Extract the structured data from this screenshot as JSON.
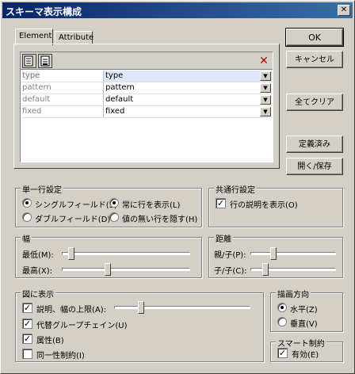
{
  "window": {
    "title": "スキーマ表示構成",
    "close_glyph": "✕"
  },
  "tabs": [
    {
      "label": "Element"
    },
    {
      "label": "Attribute"
    }
  ],
  "grid": {
    "rows": [
      {
        "name": "type",
        "value": "type"
      },
      {
        "name": "pattern",
        "value": "pattern"
      },
      {
        "name": "default",
        "value": "default"
      },
      {
        "name": "fixed",
        "value": "fixed"
      }
    ],
    "delete_glyph": "✕",
    "dropdown_glyph": "▼"
  },
  "buttons": {
    "ok": "OK",
    "cancel": "キャンセル",
    "clear_all": "全てクリア",
    "predefined": "定義済み",
    "open_save": "開く/保存"
  },
  "single_row": {
    "title": "単一行設定",
    "single_field": "シングルフィールド(S)",
    "double_field": "ダブルフィールド(D)",
    "always_show": "常に行を表示(L)",
    "hide_empty": "値の無い行を隠す(H)",
    "selected": "single_field,always_show"
  },
  "common_row": {
    "title": "共通行設定",
    "show_desc": "行の説明を表示(O)",
    "show_desc_checked": true
  },
  "width": {
    "title": "幅",
    "min_label": "最低(M):",
    "max_label": "最高(X):",
    "min_level": 0.05,
    "max_level": 0.35
  },
  "distance": {
    "title": "距離",
    "parent_child": "親/子(P):",
    "child_child": "子/子(C):",
    "pc_level": 0.25,
    "cc_level": 0.15
  },
  "diagram": {
    "title": "図に表示",
    "items": [
      {
        "label": "説明、幅の上限(A):",
        "checked": true
      },
      {
        "label": "代替グループチェイン(U)",
        "checked": true
      },
      {
        "label": "属性(B)",
        "checked": true
      },
      {
        "label": "同一性制約(I)",
        "checked": false
      }
    ],
    "desc_level": 0.18,
    "check_glyph": "✓"
  },
  "direction": {
    "title": "描画方向",
    "horizontal": "水平(Z)",
    "vertical": "垂直(V)",
    "selected": "horizontal"
  },
  "smart": {
    "title": "スマート制約",
    "enabled": "有効(E)",
    "enabled_checked": true
  }
}
